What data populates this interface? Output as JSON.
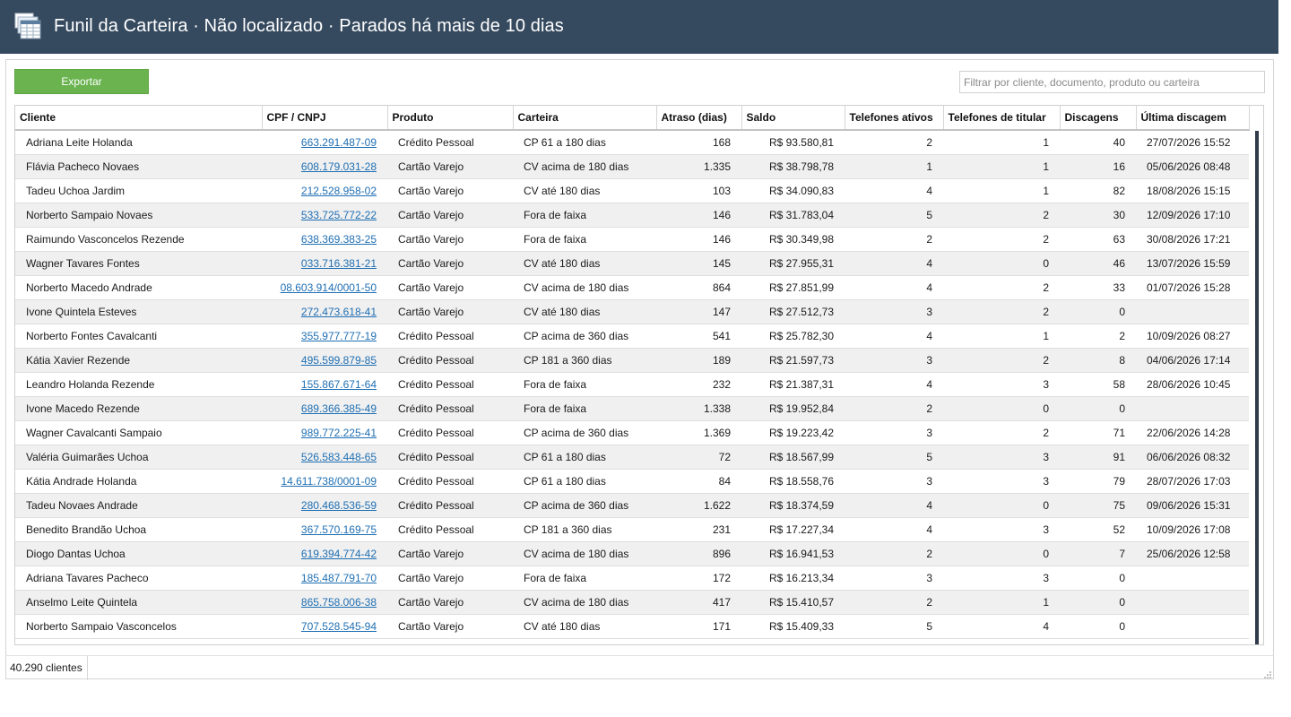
{
  "window": {
    "title": "Funil da Carteira · Não localizado · Parados há mais de 10 dias",
    "icon": "table-grid-icon"
  },
  "toolbar": {
    "export_label": "Exportar",
    "filter_placeholder": "Filtrar por cliente, documento, produto ou carteira",
    "filter_value": ""
  },
  "colors": {
    "titlebar": "#364a5f",
    "export_button": "#6ab34f",
    "link": "#1f6fb3",
    "alt_row": "#f0f0f0"
  },
  "table": {
    "columns": [
      "Cliente",
      "CPF / CNPJ",
      "Produto",
      "Carteira",
      "Atraso (dias)",
      "Saldo",
      "Telefones ativos",
      "Telefones de titular",
      "Discagens",
      "Última discagem"
    ],
    "rows": [
      [
        "Adriana Leite Holanda",
        "663.291.487-09",
        "Crédito Pessoal",
        "CP 61 a 180 dias",
        "168",
        "R$ 93.580,81",
        "2",
        "1",
        "40",
        "27/07/2026 15:52"
      ],
      [
        "Flávia Pacheco Novaes",
        "608.179.031-28",
        "Cartão Varejo",
        "CV acima de 180 dias",
        "1.335",
        "R$ 38.798,78",
        "1",
        "1",
        "16",
        "05/06/2026 08:48"
      ],
      [
        "Tadeu Uchoa Jardim",
        "212.528.958-02",
        "Cartão Varejo",
        "CV até 180 dias",
        "103",
        "R$ 34.090,83",
        "4",
        "1",
        "82",
        "18/08/2026 15:15"
      ],
      [
        "Norberto Sampaio Novaes",
        "533.725.772-22",
        "Cartão Varejo",
        "Fora de faixa",
        "146",
        "R$ 31.783,04",
        "5",
        "2",
        "30",
        "12/09/2026 17:10"
      ],
      [
        "Raimundo Vasconcelos Rezende",
        "638.369.383-25",
        "Cartão Varejo",
        "Fora de faixa",
        "146",
        "R$ 30.349,98",
        "2",
        "2",
        "63",
        "30/08/2026 17:21"
      ],
      [
        "Wagner Tavares Fontes",
        "033.716.381-21",
        "Cartão Varejo",
        "CV até 180 dias",
        "145",
        "R$ 27.955,31",
        "4",
        "0",
        "46",
        "13/07/2026 15:59"
      ],
      [
        "Norberto Macedo Andrade",
        "08.603.914/0001-50",
        "Cartão Varejo",
        "CV acima de 180 dias",
        "864",
        "R$ 27.851,99",
        "4",
        "2",
        "33",
        "01/07/2026 15:28"
      ],
      [
        "Ivone Quintela Esteves",
        "272.473.618-41",
        "Cartão Varejo",
        "CV até 180 dias",
        "147",
        "R$ 27.512,73",
        "3",
        "2",
        "0",
        ""
      ],
      [
        "Norberto Fontes Cavalcanti",
        "355.977.777-19",
        "Crédito Pessoal",
        "CP acima de 360 dias",
        "541",
        "R$ 25.782,30",
        "4",
        "1",
        "2",
        "10/09/2026 08:27"
      ],
      [
        "Kátia Xavier Rezende",
        "495.599.879-85",
        "Crédito Pessoal",
        "CP 181 a 360 dias",
        "189",
        "R$ 21.597,73",
        "3",
        "2",
        "8",
        "04/06/2026 17:14"
      ],
      [
        "Leandro Holanda Rezende",
        "155.867.671-64",
        "Crédito Pessoal",
        "Fora de faixa",
        "232",
        "R$ 21.387,31",
        "4",
        "3",
        "58",
        "28/06/2026 10:45"
      ],
      [
        "Ivone Macedo Rezende",
        "689.366.385-49",
        "Crédito Pessoal",
        "Fora de faixa",
        "1.338",
        "R$ 19.952,84",
        "2",
        "0",
        "0",
        ""
      ],
      [
        "Wagner Cavalcanti Sampaio",
        "989.772.225-41",
        "Crédito Pessoal",
        "CP acima de 360 dias",
        "1.369",
        "R$ 19.223,42",
        "3",
        "2",
        "71",
        "22/06/2026 14:28"
      ],
      [
        "Valéria Guimarães Uchoa",
        "526.583.448-65",
        "Crédito Pessoal",
        "CP 61 a 180 dias",
        "72",
        "R$ 18.567,99",
        "5",
        "3",
        "91",
        "06/06/2026 08:32"
      ],
      [
        "Kátia Andrade Holanda",
        "14.611.738/0001-09",
        "Crédito Pessoal",
        "CP 61 a 180 dias",
        "84",
        "R$ 18.558,76",
        "3",
        "3",
        "79",
        "28/07/2026 17:03"
      ],
      [
        "Tadeu Novaes Andrade",
        "280.468.536-59",
        "Crédito Pessoal",
        "CP acima de 360 dias",
        "1.622",
        "R$ 18.374,59",
        "4",
        "0",
        "75",
        "09/06/2026 15:31"
      ],
      [
        "Benedito Brandão Uchoa",
        "367.570.169-75",
        "Crédito Pessoal",
        "CP 181 a 360 dias",
        "231",
        "R$ 17.227,34",
        "4",
        "3",
        "52",
        "10/09/2026 17:08"
      ],
      [
        "Diogo Dantas Uchoa",
        "619.394.774-42",
        "Cartão Varejo",
        "CV acima de 180 dias",
        "896",
        "R$ 16.941,53",
        "2",
        "0",
        "7",
        "25/06/2026 12:58"
      ],
      [
        "Adriana Tavares Pacheco",
        "185.487.791-70",
        "Cartão Varejo",
        "Fora de faixa",
        "172",
        "R$ 16.213,34",
        "3",
        "3",
        "0",
        ""
      ],
      [
        "Anselmo Leite Quintela",
        "865.758.006-38",
        "Cartão Varejo",
        "CV acima de 180 dias",
        "417",
        "R$ 15.410,57",
        "2",
        "1",
        "0",
        ""
      ],
      [
        "Norberto Sampaio Vasconcelos",
        "707.528.545-94",
        "Cartão Varejo",
        "CV até 180 dias",
        "171",
        "R$ 15.409,33",
        "5",
        "4",
        "0",
        ""
      ]
    ]
  },
  "status": {
    "count_text": "40.290 clientes"
  }
}
